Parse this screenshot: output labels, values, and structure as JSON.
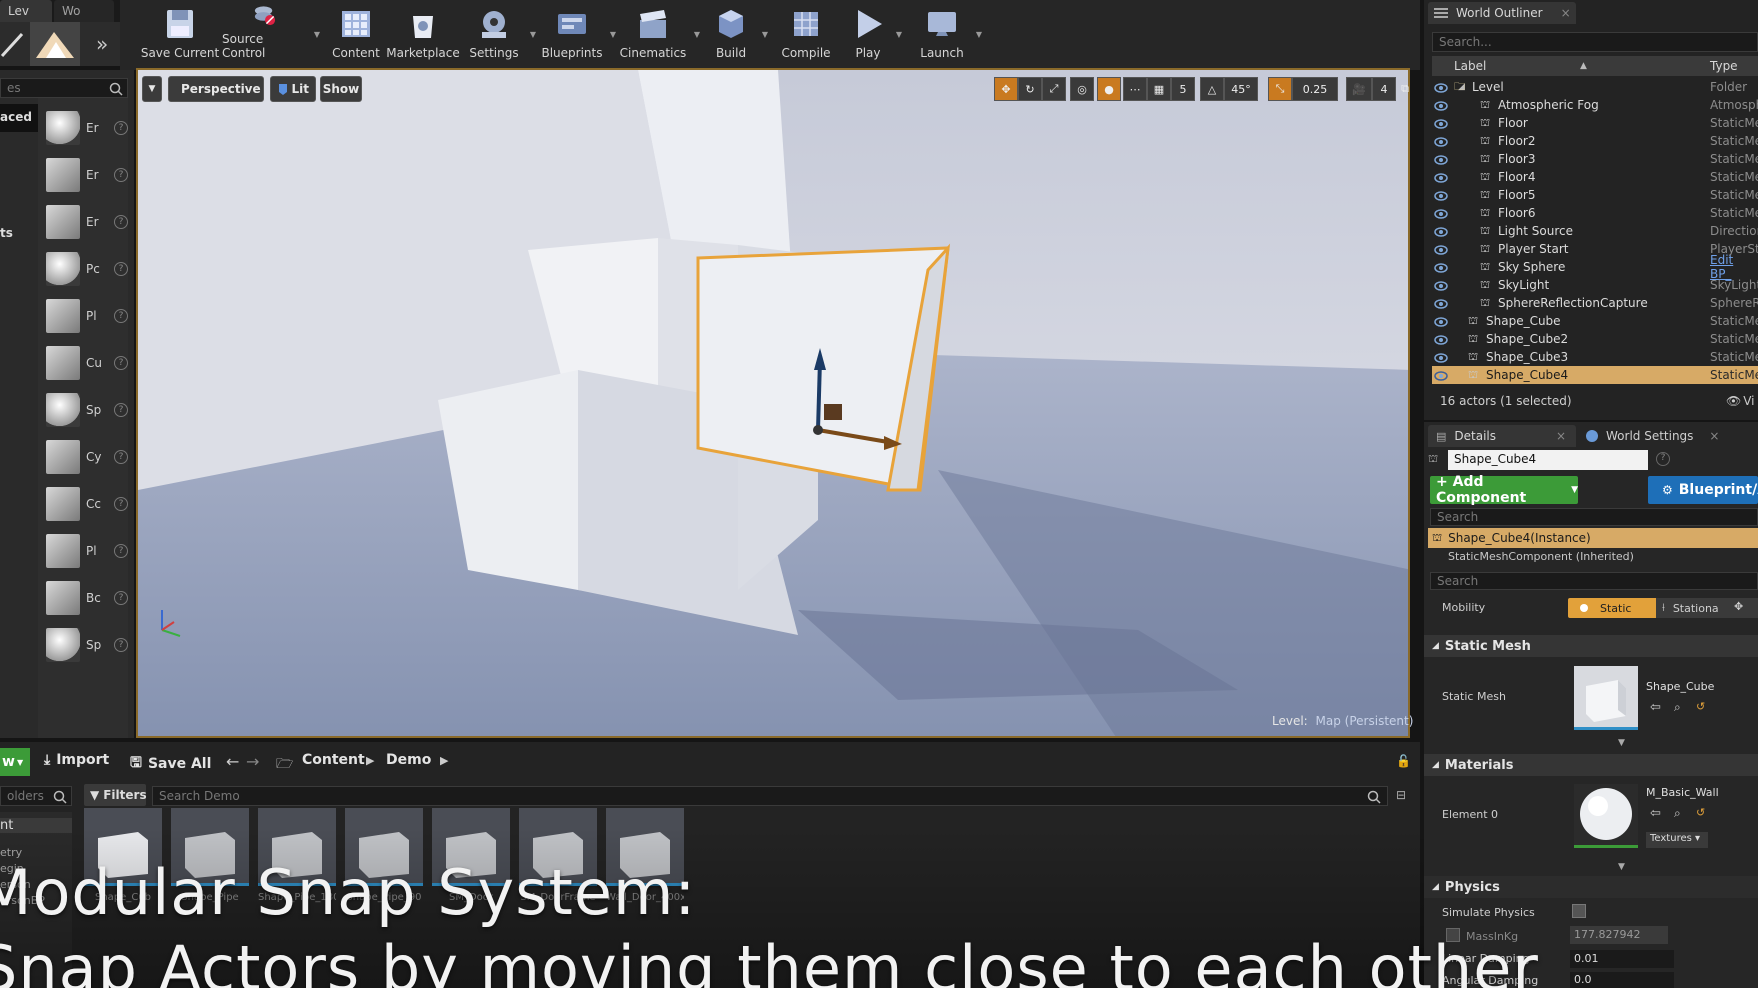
{
  "tabs_top": {
    "level": "Lev",
    "world": "Wo"
  },
  "toolbar": {
    "save_current": "Save Current",
    "source_control": "Source Control",
    "content": "Content",
    "marketplace": "Marketplace",
    "settings": "Settings",
    "blueprints": "Blueprints",
    "cinematics": "Cinematics",
    "build": "Build",
    "compile": "Compile",
    "play": "Play",
    "launch": "Launch",
    "more": "»"
  },
  "place_panel": {
    "search_placeholder": "es",
    "categories": [
      "aced",
      "ts"
    ],
    "items": [
      "Er",
      "Er",
      "Er",
      "Pc",
      "Pl",
      "Cu",
      "Sp",
      "Cy",
      "Cc",
      "Pl",
      "Bc",
      "Sp"
    ]
  },
  "viewport": {
    "perspective": "Perspective",
    "lit": "Lit",
    "show": "Show",
    "grid_snap": "5",
    "rotation_snap": "45°",
    "scale_snap": "0.25",
    "camera_speed": "4",
    "level_label": "Level:",
    "level_name": "Map (Persistent)"
  },
  "outliner": {
    "tab": "World Outliner",
    "search_placeholder": "Search...",
    "col_label": "Label",
    "col_type": "Type",
    "rows": [
      {
        "label": "Level",
        "type": "Folder"
      },
      {
        "label": "Atmospheric Fog",
        "type": "Atmosph"
      },
      {
        "label": "Floor",
        "type": "StaticMe"
      },
      {
        "label": "Floor2",
        "type": "StaticMe"
      },
      {
        "label": "Floor3",
        "type": "StaticMe"
      },
      {
        "label": "Floor4",
        "type": "StaticMe"
      },
      {
        "label": "Floor5",
        "type": "StaticMe"
      },
      {
        "label": "Floor6",
        "type": "StaticMe"
      },
      {
        "label": "Light Source",
        "type": "Direction"
      },
      {
        "label": "Player Start",
        "type": "PlayerSta"
      },
      {
        "label": "Sky Sphere",
        "type": "Edit BP_"
      },
      {
        "label": "SkyLight",
        "type": "SkyLight"
      },
      {
        "label": "SphereReflectionCapture",
        "type": "SphereRe"
      },
      {
        "label": "Shape_Cube",
        "type": "StaticMe"
      },
      {
        "label": "Shape_Cube2",
        "type": "StaticMe"
      },
      {
        "label": "Shape_Cube3",
        "type": "StaticMe"
      },
      {
        "label": "Shape_Cube4",
        "type": "StaticMe"
      }
    ],
    "status": "16 actors (1 selected)",
    "view_options": "Vi"
  },
  "details": {
    "tab_details": "Details",
    "tab_world": "World Settings",
    "name_value": "Shape_Cube4",
    "add_component": "+ Add Component",
    "blueprint": "Blueprint/A",
    "search1": "Search",
    "instance": "Shape_Cube4(Instance)",
    "inherited": "StaticMeshComponent (Inherited)",
    "search2": "Search",
    "mobility_label": "Mobility",
    "mobility_static": "Static",
    "mobility_stationary": "Stationa",
    "sec_static_mesh": "Static Mesh",
    "static_mesh_label": "Static Mesh",
    "static_mesh_value": "Shape_Cube",
    "sec_materials": "Materials",
    "element0_label": "Element 0",
    "element0_value": "M_Basic_Wall",
    "textures": "Textures",
    "sec_physics": "Physics",
    "simulate_physics": "Simulate Physics",
    "mass_label": "MassInKg",
    "mass_value": "177.827942",
    "linear_damping_label": "Linear Damping",
    "linear_damping_value": "0.01",
    "angular_damping_label": "Angular Damping",
    "angular_damping_value": "0.0"
  },
  "content_browser": {
    "new": "w",
    "import": "Import",
    "save_all": "Save All",
    "path_content": "Content",
    "path_demo": "Demo",
    "folders_placeholder": "olders",
    "filters": "Filters",
    "search_placeholder": "Search Demo",
    "tree": [
      "nt",
      "etry",
      "egin",
      "erson",
      "ersonBP"
    ],
    "assets": [
      "Shape_Cub",
      "Shape_Pipe",
      "Shape_Pipe_180",
      "Shape_Pipe_90",
      "SM_Door",
      "SM_DoorFrame",
      "Wall_Door_400x300"
    ]
  },
  "caption": {
    "line1": "Modular Snap System:",
    "line2": "Snap Actors by moving them close to each other"
  },
  "colors": {
    "selection": "#d7aa66",
    "add_component": "#3c9b38",
    "blueprint": "#1e6fb8",
    "accent_blue": "#2f8fc7",
    "outline": "#e8a33a"
  }
}
